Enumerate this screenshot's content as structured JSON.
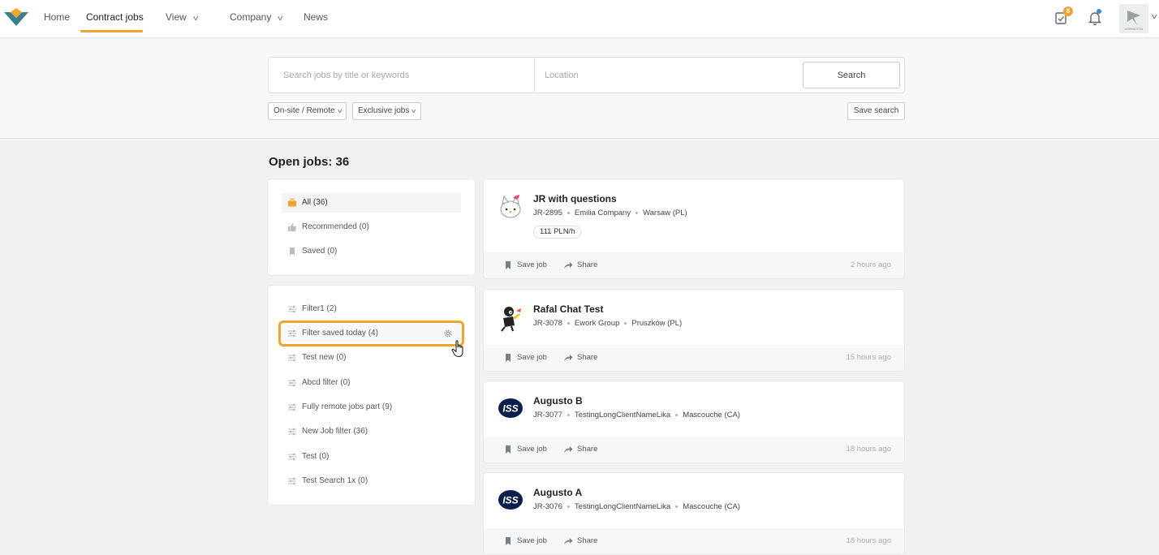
{
  "nav": {
    "items": [
      {
        "label": "Home"
      },
      {
        "label": "Contract jobs"
      },
      {
        "label": "View"
      },
      {
        "label": "Company"
      },
      {
        "label": "News"
      }
    ],
    "tasks_badge": "6",
    "avatar_text": "WORKMOTION"
  },
  "search": {
    "keywords_placeholder": "Search jobs by title or keywords",
    "location_placeholder": "Location",
    "button_label": "Search",
    "filters": [
      {
        "label": "On-site / Remote"
      },
      {
        "label": "Exclusive jobs"
      }
    ],
    "save_search_label": "Save search"
  },
  "open_jobs_label": "Open jobs: 36",
  "sidebar": {
    "main": [
      {
        "label": "All (36)",
        "icon": "briefcase-icon"
      },
      {
        "label": "Recommended (0)",
        "icon": "thumbs-up-icon"
      },
      {
        "label": "Saved (0)",
        "icon": "bookmark-icon"
      }
    ],
    "saved_filters": [
      {
        "label": "Filter1 (2)"
      },
      {
        "label": "Filter saved today (4)"
      },
      {
        "label": "Test new (0)"
      },
      {
        "label": "Abcd filter (0)"
      },
      {
        "label": "Fully remote jobs part (9)"
      },
      {
        "label": "New Job filter (36)"
      },
      {
        "label": "Test (0)"
      },
      {
        "label": "Test Search 1x (0)"
      }
    ]
  },
  "jobs": [
    {
      "title": "JR with questions",
      "id": "JR-2895",
      "company": "Emilia Company",
      "location": "Warsaw (PL)",
      "rate": "111 PLN/h",
      "posted": "2 hours ago",
      "logo": "kitty-logo"
    },
    {
      "title": "Rafal Chat Test",
      "id": "JR-3078",
      "company": "Ework Group",
      "location": "Pruszków (PL)",
      "posted": "15 hours ago",
      "logo": "cartoon-logo"
    },
    {
      "title": "Augusto B",
      "id": "JR-3077",
      "company": "TestingLongClientNameLika",
      "location": "Mascouche (CA)",
      "posted": "18 hours ago",
      "logo": "iss-logo"
    },
    {
      "title": "Augusto A",
      "id": "JR-3076",
      "company": "TestingLongClientNameLika",
      "location": "Mascouche (CA)",
      "posted": "18 hours ago",
      "logo": "iss-logo"
    }
  ],
  "job_actions": {
    "save": "Save job",
    "share": "Share"
  },
  "colors": {
    "accent": "#f0a52a",
    "logo_teal": "#3a7f8c",
    "notify_blue": "#2f8fe8"
  }
}
